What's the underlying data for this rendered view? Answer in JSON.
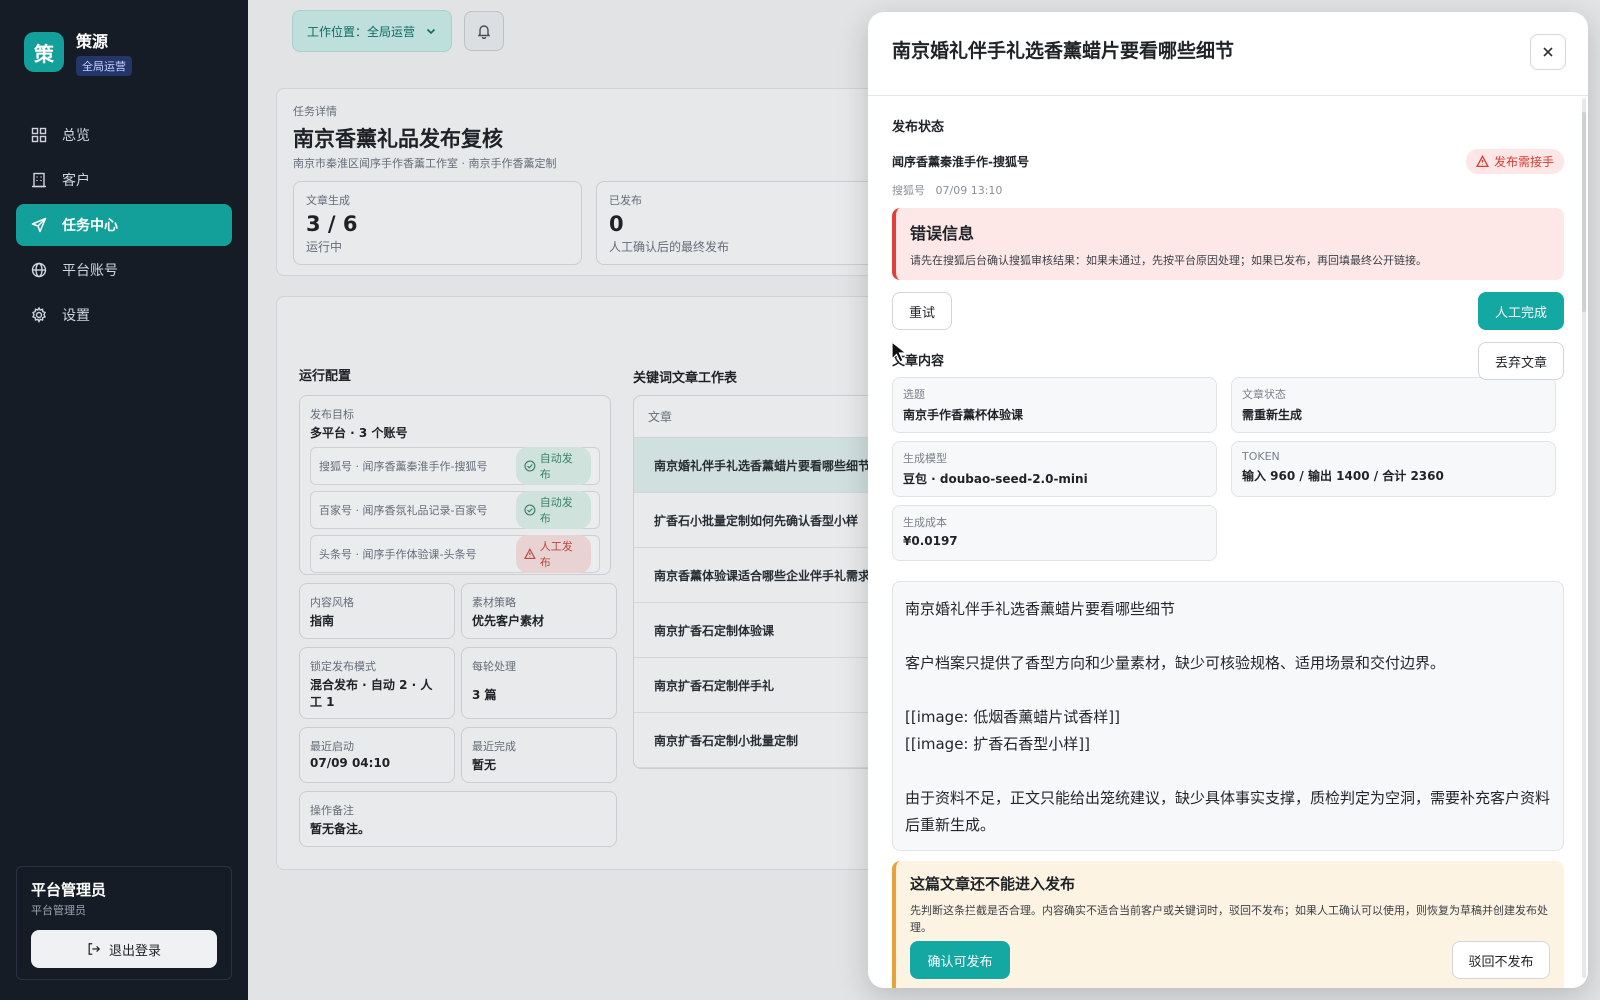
{
  "sidebar": {
    "brand_logo": "策",
    "brand_name": "策源",
    "brand_badge": "全局运营",
    "nav": [
      {
        "label": "总览",
        "icon": "dashboard-grid-icon"
      },
      {
        "label": "客户",
        "icon": "building-icon"
      },
      {
        "label": "任务中心",
        "icon": "send-icon",
        "active": true
      },
      {
        "label": "平台账号",
        "icon": "globe-icon"
      },
      {
        "label": "设置",
        "icon": "gear-icon"
      }
    ],
    "user": {
      "name": "平台管理员",
      "role": "平台管理员",
      "logout_label": "退出登录"
    }
  },
  "topbar": {
    "workspace_label": "工作位置：全局运营"
  },
  "task": {
    "eyebrow": "任务详情",
    "title": "南京香薰礼品发布复核",
    "subtitle": "南京市秦淮区闻序手作香薰工作室 · 南京手作香薰定制",
    "stats": [
      {
        "label": "文章生成",
        "value": "3 / 6",
        "note": "运行中"
      },
      {
        "label": "已发布",
        "value": "0",
        "note": "人工确认后的最终发布"
      }
    ]
  },
  "config": {
    "title": "运行配置",
    "target_label": "发布目标",
    "target_value": "多平台 · 3 个账号",
    "accounts": [
      {
        "name": "搜狐号 · 闻序香薰秦淮手作-搜狐号",
        "mode": "自动发布",
        "status": "ok"
      },
      {
        "name": "百家号 · 闻序香氛礼品记录-百家号",
        "mode": "自动发布",
        "status": "ok"
      },
      {
        "name": "头条号 · 闻序手作体验课-头条号",
        "mode": "人工发布",
        "status": "warn"
      }
    ],
    "cells": [
      {
        "label": "内容风格",
        "value": "指南"
      },
      {
        "label": "素材策略",
        "value": "优先客户素材"
      },
      {
        "label": "锁定发布模式",
        "value": "混合发布 · 自动 2 · 人工 1"
      },
      {
        "label": "每轮处理",
        "value": "3 篇"
      },
      {
        "label": "最近启动",
        "value": "07/09 04:10"
      },
      {
        "label": "最近完成",
        "value": "暂无"
      }
    ],
    "note_label": "操作备注",
    "note_value": "暂无备注。"
  },
  "worksheet": {
    "title": "关键词文章工作表",
    "column": "文章",
    "rows": [
      "南京婚礼伴手礼选香薰蜡片要看哪些细节",
      "扩香石小批量定制如何先确认香型小样",
      "南京香薰体验课适合哪些企业伴手礼需求",
      "南京扩香石定制体验课",
      "南京扩香石定制伴手礼",
      "南京扩香石定制小批量定制"
    ]
  },
  "modal": {
    "title": "南京婚礼伴手礼选香薰蜡片要看哪些细节",
    "publish_status_label": "发布状态",
    "account": "闻序香薰秦淮手作-搜狐号",
    "status_badge": "发布需接手",
    "meta_platform": "搜狐号",
    "meta_time": "07/09 13:10",
    "error_title": "错误信息",
    "error_text": "请先在搜狐后台确认搜狐审核结果：如果未通过，先按平台原因处理；如果已发布，再回填最终公开链接。",
    "retry_label": "重试",
    "manual_done_label": "人工完成",
    "discard_label": "丢弃文章",
    "content_label": "文章内容",
    "fields": [
      {
        "label": "选题",
        "value": "南京手作香薰杯体验课"
      },
      {
        "label": "文章状态",
        "value": "需重新生成"
      },
      {
        "label": "生成模型",
        "value": "豆包 · doubao-seed-2.0-mini"
      },
      {
        "label": "TOKEN",
        "value": "输入 960 / 输出 1400 / 合计 2360"
      },
      {
        "label": "生成成本",
        "value": "¥0.0197"
      }
    ],
    "article": {
      "title": "南京婚礼伴手礼选香薰蜡片要看哪些细节",
      "p1": "客户档案只提供了香型方向和少量素材，缺少可核验规格、适用场景和交付边界。",
      "img1": "[[image: 低烟香薰蜡片试香样]]",
      "img2": "[[image: 扩香石香型小样]]",
      "p2": "由于资料不足，正文只能给出笼统建议，缺少具体事实支撑，质检判定为空洞，需要补充客户资料后重新生成。"
    },
    "notice_title": "这篇文章还不能进入发布",
    "notice_text": "先判断这条拦截是否合理。内容确实不适合当前客户或关键词时，驳回不发布；如果人工确认可以使用，则恢复为草稿并创建发布处理。",
    "confirm_label": "确认可发布",
    "reject_label": "驳回不发布"
  },
  "colors": {
    "accent": "#13a8a2",
    "sidebar": "#161c26",
    "danger": "#e0403a",
    "warning": "#e9a23a"
  }
}
